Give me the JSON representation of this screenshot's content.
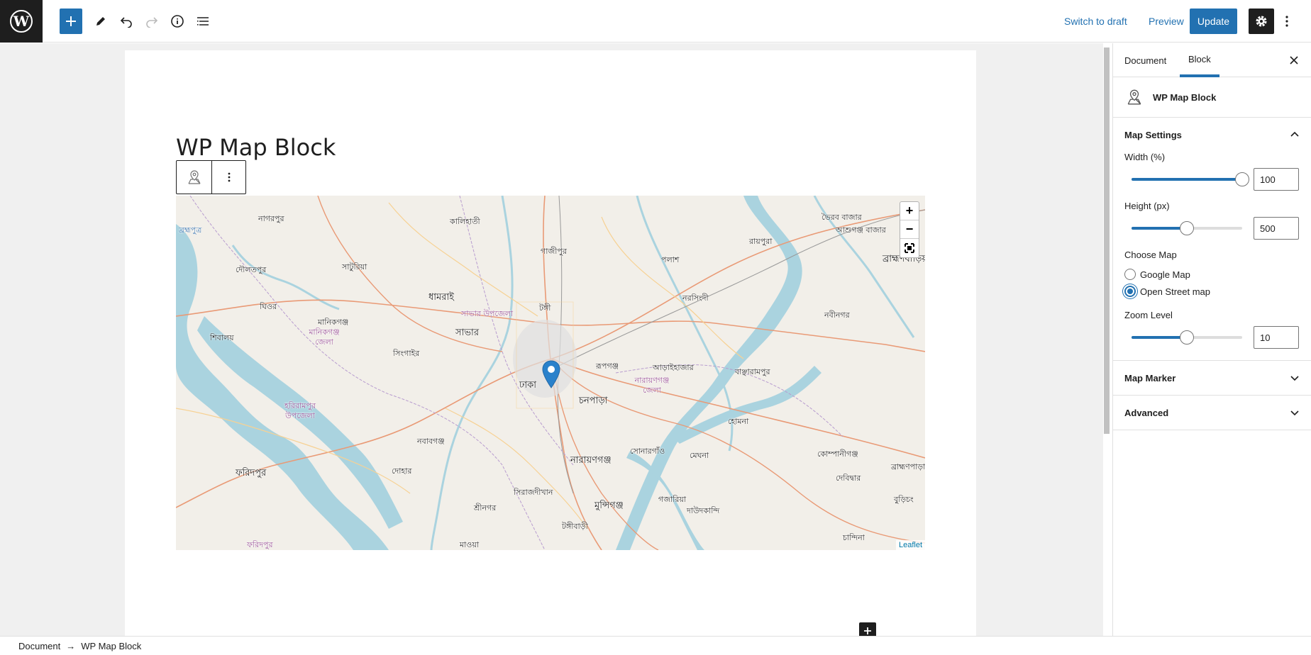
{
  "topbar": {
    "add_label": "+",
    "switch_to_draft": "Switch to draft",
    "preview": "Preview",
    "update": "Update"
  },
  "post": {
    "title": "WP Map Block"
  },
  "map": {
    "labels": {
      "nagarpur": "নাগরপুর",
      "kalihati": "কালিহাতী",
      "bhairab_bazar": "ভৈরব বাজার",
      "ashuganj": "আশুগঞ্জ বাজার",
      "brahmanbaria": "ব্রাহ্মণবাড়িয়া",
      "brahmaputra": "ব্রহ্মপুত্র",
      "daulatpur": "দৌলতপুর",
      "saturia": "সাটুরিয়া",
      "gazipur": "গাজীপুর",
      "raypura": "রায়পুরা",
      "palash": "পলাশ",
      "dhamrai": "ধামরাই",
      "narsingdi": "নরসিংদী",
      "savar_upazila": "সাভার উপজেলা",
      "tongi": "টঙ্গী",
      "ghior": "ঘিওর",
      "manikganj": "মানিকগঞ্জ",
      "nabinagar": "নবীনগর",
      "shibalaya": "শিবালয়",
      "manikganj_district": "মানিকগঞ্জ জেলা",
      "savar": "সাভার",
      "singair": "সিংগাইর",
      "rupganj": "রূপগঞ্জ",
      "araihazar": "আড়াইহাজার",
      "bancharampur": "বাঞ্ছারামপুর",
      "dhaka": "ঢাকা",
      "narayanganj_district": "নারায়ণগঞ্জ জেলা",
      "chanpara": "চনপাড়া",
      "harirampur": "হরিরামপুর উপজেলা",
      "homna": "হোমনা",
      "nawabganj": "নবাবগঞ্জ",
      "sonargaon": "সোনারগাঁও",
      "meghna": "মেঘনা",
      "companiganj": "কোম্পানীগঞ্জ",
      "dohar": "দোহার",
      "narayanganj": "নারায়ণগঞ্জ",
      "faridpur": "ফরিদপুর",
      "debidwar": "দেবিদ্বার",
      "brahmanpara": "ব্রাহ্মণপাড়া",
      "sirajdikhan": "সিরাজদীখান",
      "gazaria": "গজারিয়া",
      "sreenagar": "শ্রীনগর",
      "munshiganj": "মুন্সিগঞ্জ",
      "daudkandi": "দাউদকান্দি",
      "burichang": "বুড়িচং",
      "tongibari": "টঙ্গীবাড়ী",
      "chandina": "চান্দিনা",
      "faridpur_bottom": "ফরিদপুর",
      "mawa": "মাওয়া"
    },
    "zoom_in": "+",
    "zoom_out": "−",
    "attribution": "Leaflet"
  },
  "sidebar": {
    "tab_document": "Document",
    "tab_block": "Block",
    "block_name": "WP Map Block",
    "map_settings": {
      "title": "Map Settings",
      "width_label": "Width (%)",
      "width_value": "100",
      "width_fraction": 1.0,
      "height_label": "Height (px)",
      "height_value": "500",
      "choose_map_label": "Choose Map",
      "option_google": "Google Map",
      "option_osm": "Open Street map",
      "selected": "Open Street map",
      "zoom_label": "Zoom Level",
      "zoom_value": "10"
    },
    "map_marker": "Map Marker",
    "advanced": "Advanced"
  },
  "breadcrumb": {
    "root": "Document",
    "arrow": "→",
    "current": "WP Map Block"
  },
  "colors": {
    "accent": "#2271b1",
    "dark": "#1e1e1e",
    "map_land": "#f2efe9",
    "map_water": "#aad3df"
  }
}
